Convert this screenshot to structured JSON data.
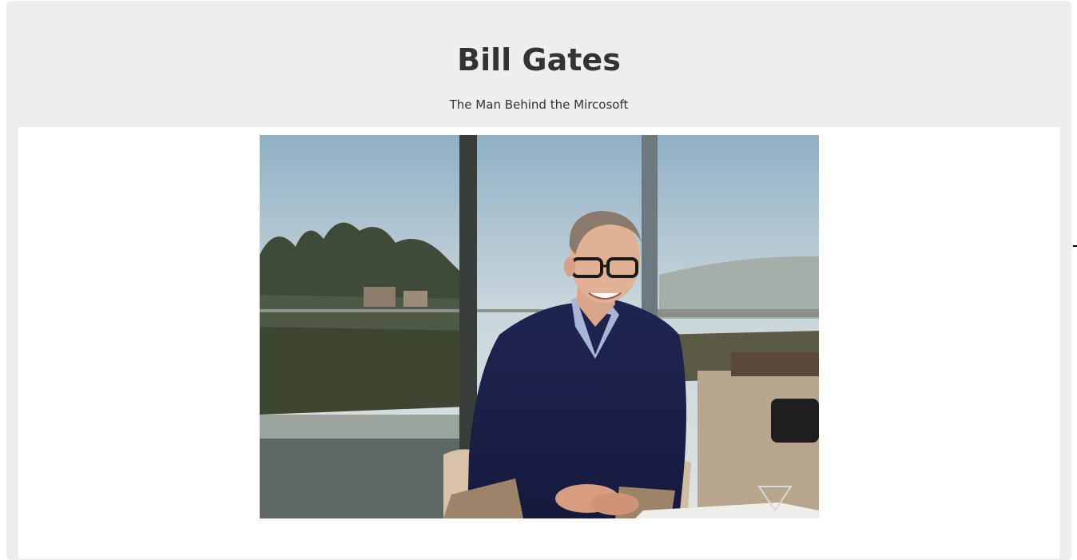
{
  "header": {
    "title": "Bill Gates",
    "subtitle": "The Man Behind the Mircosoft"
  },
  "image": {
    "subject": "portrait-photo"
  },
  "colors": {
    "panel_bg": "#eeeeee",
    "text": "#333333",
    "image_bg": "#ffffff"
  }
}
